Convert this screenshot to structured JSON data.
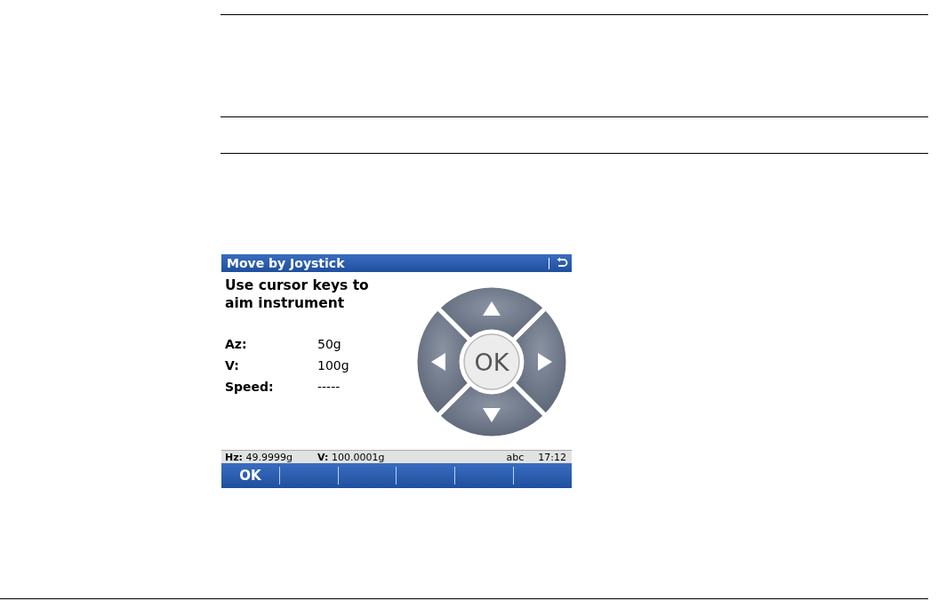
{
  "screen": {
    "title": "Move by Joystick",
    "instruction": "Use cursor keys to aim instrument",
    "fields": [
      {
        "label": "Az:",
        "value": "50g"
      },
      {
        "label": "V:",
        "value": "100g"
      },
      {
        "label": "Speed:",
        "value": "-----"
      }
    ],
    "joystick": {
      "center_label": "OK"
    },
    "status_bar": {
      "hz_label": "Hz:",
      "hz_value": "49.9999g",
      "v_label": "V:",
      "v_value": "100.0001g",
      "input_mode": "abc",
      "time": "17:12"
    },
    "softkeys": [
      {
        "label": "OK"
      }
    ]
  }
}
